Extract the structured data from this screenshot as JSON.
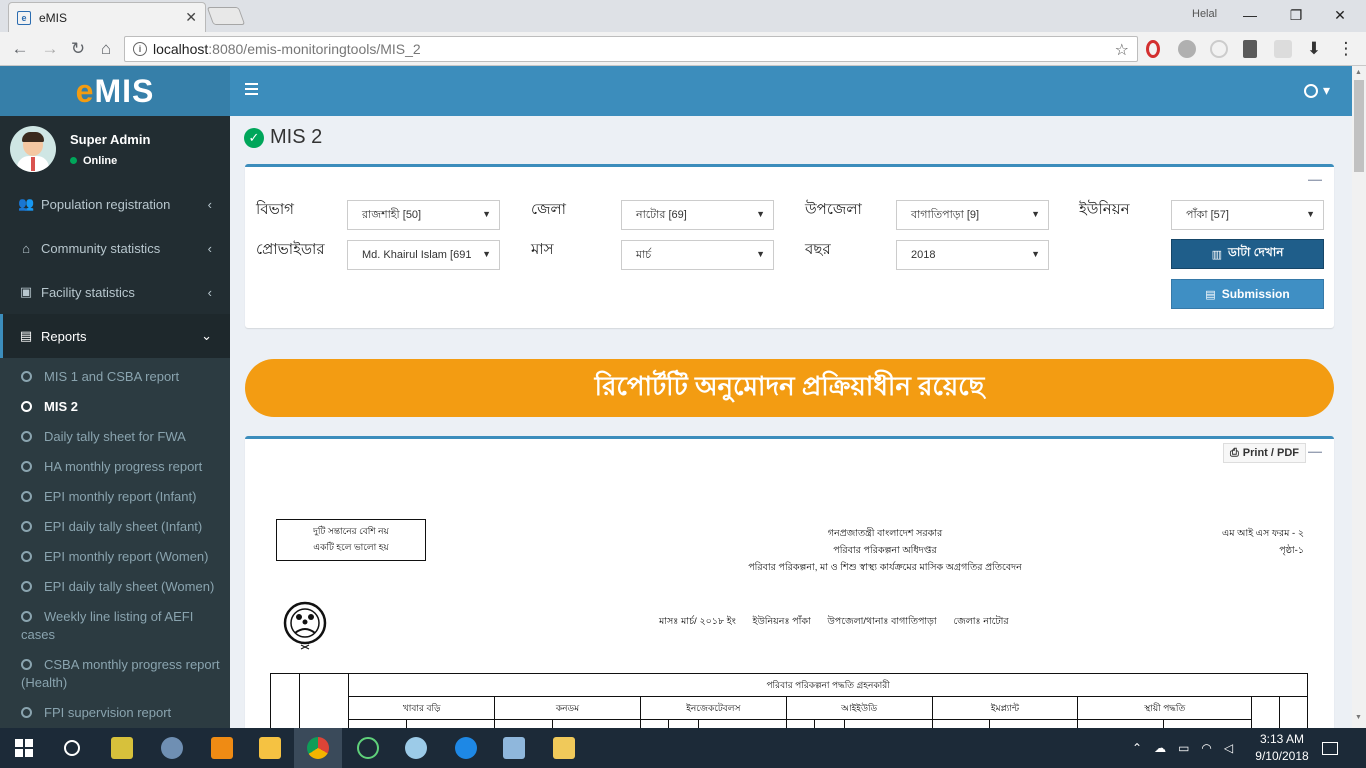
{
  "browser": {
    "tab_title": "eMIS",
    "window_user": "Helal",
    "url_host": "localhost",
    "url_path": ":8080/emis-monitoringtools/MIS_2"
  },
  "app": {
    "logo_e": "e",
    "logo_rest": "MIS",
    "user": {
      "name": "Super Admin",
      "status": "Online"
    },
    "menu": [
      {
        "label": "Population registration",
        "icon": "users-icon"
      },
      {
        "label": "Community statistics",
        "icon": "home-icon"
      },
      {
        "label": "Facility statistics",
        "icon": "briefcase-icon"
      },
      {
        "label": "Reports",
        "icon": "report-icon"
      }
    ],
    "submenu": [
      "MIS 1 and CSBA report",
      "MIS 2",
      "Daily tally sheet for FWA",
      "HA monthly progress report",
      "EPI monthly report (Infant)",
      "EPI daily tally sheet (Infant)",
      "EPI monthly report (Women)",
      "EPI daily tally sheet (Women)",
      "Weekly line listing of AEFI cases",
      "CSBA monthly progress report (Health)",
      "FPI supervision report"
    ]
  },
  "page": {
    "title": "MIS 2",
    "filters": {
      "division_label": "বিভাগ",
      "division_value": "রাজশাহী [50]",
      "district_label": "জেলা",
      "district_value": "নাটোর [69]",
      "upazila_label": "উপজেলা",
      "upazila_value": "বাগাতিপাড়া [9]",
      "union_label": "ইউনিয়ন",
      "union_value": "পাঁকা [57]",
      "provider_label": "প্রোভাইডার",
      "provider_value": "Md. Khairul Islam [691",
      "month_label": "মাস",
      "month_value": "মার্চ",
      "year_label": "বছর",
      "year_value": "2018",
      "show_button": "ডাটা দেখান",
      "submit_button": "Submission"
    },
    "banner": "রিপোর্টটি অনুমোদন প্রক্রিয়াধীন রয়েছে",
    "print_button": "Print / PDF",
    "report": {
      "slogan_1": "দুটি সন্তানের বেশি নয়",
      "slogan_2": "একটি হলে ভালো হয়",
      "gov_1": "গনপ্রজাতন্ত্রী বাংলাদেশ সরকার",
      "gov_2": "পরিবার পরিকল্পনা অধিদপ্তর",
      "gov_3": "পরিবার পরিকল্পনা, মা ও শিশু স্বাস্থ্য কার্যক্রমের মাসিক অগ্রগতির প্রতিবেদন",
      "form_no": "এম আই এস ফরম - ২",
      "page_no": "পৃষ্ঠা-১",
      "meta_month": "মাসঃ মার্চ/ ২০১৮ ইং",
      "meta_union": "ইউনিয়নঃ পাঁকা",
      "meta_upazila": "উপজেলা/থানাঃ বাগাতিপাড়া",
      "meta_district": "জেলাঃ নাটোর",
      "table_header": "পরিবার পরিকল্পনা পদ্ধতি গ্রহনকারী",
      "methods": [
        "খাবার বড়ি",
        "কনডম",
        "ইনজেকটেবলস",
        "আইইউডি",
        "ইমপ্ল্যান্ট",
        "স্থায়ী পদ্ধতি"
      ]
    }
  },
  "taskbar": {
    "time": "3:13 AM",
    "date": "9/10/2018"
  },
  "colors": {
    "sidebar": "#222d32",
    "header": "#3c8dbc",
    "banner": "#f39c12"
  }
}
